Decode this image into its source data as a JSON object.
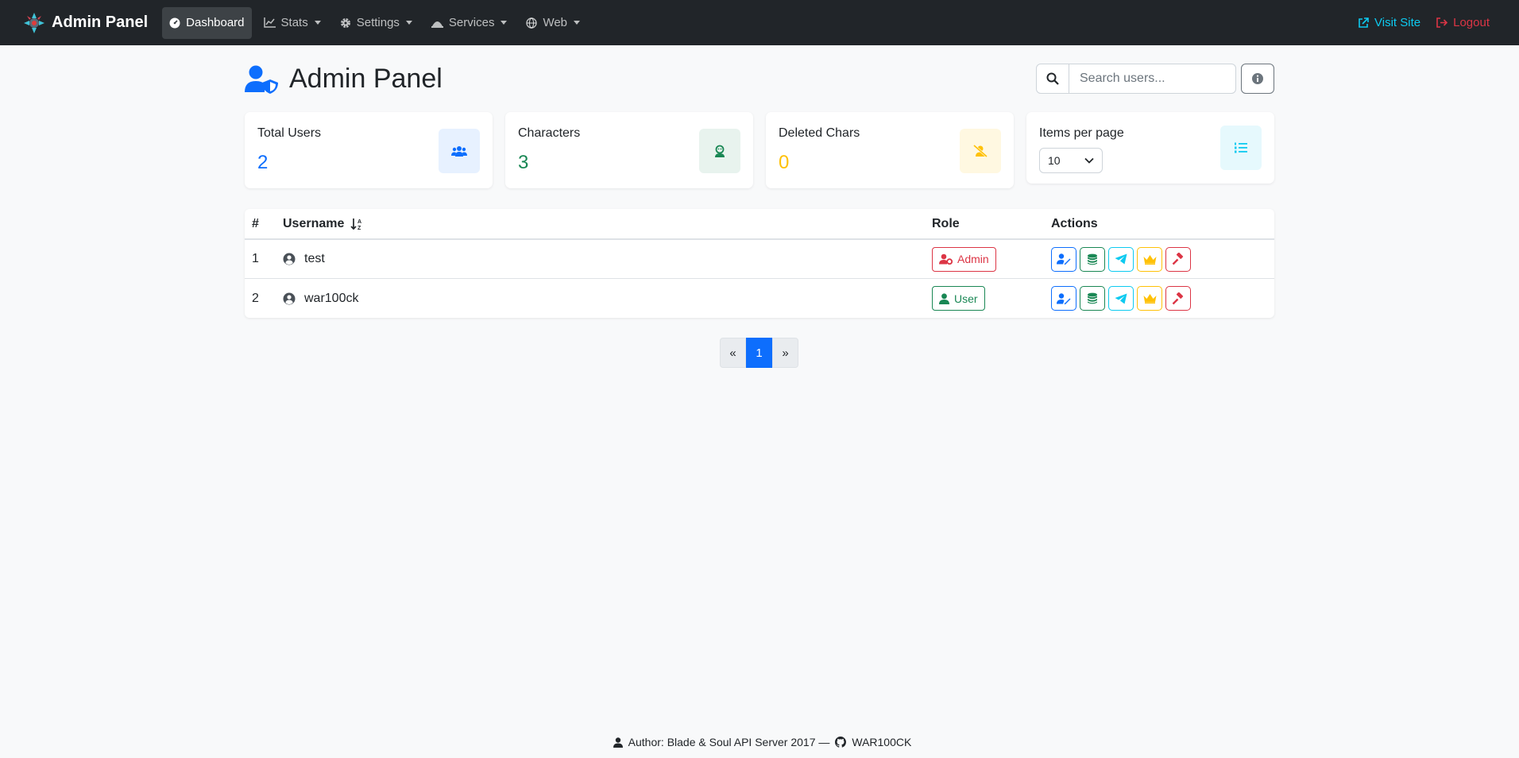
{
  "navbar": {
    "brand": "Admin Panel",
    "items": [
      {
        "label": "Dashboard",
        "icon": "dashboard-icon",
        "active": true
      },
      {
        "label": "Stats",
        "icon": "chart-icon",
        "dropdown": true
      },
      {
        "label": "Settings",
        "icon": "gear-icon",
        "dropdown": true
      },
      {
        "label": "Services",
        "icon": "bell-service-icon",
        "dropdown": true
      },
      {
        "label": "Web",
        "icon": "globe-icon",
        "dropdown": true
      }
    ],
    "visit_site": "Visit Site",
    "logout": "Logout"
  },
  "header": {
    "title": "Admin Panel",
    "search_placeholder": "Search users..."
  },
  "stats": {
    "total_users": {
      "label": "Total Users",
      "value": "2",
      "color": "#0d6efd"
    },
    "characters": {
      "label": "Characters",
      "value": "3",
      "color": "#198754"
    },
    "deleted_chars": {
      "label": "Deleted Chars",
      "value": "0",
      "color": "#ffc107"
    },
    "items_per_page": {
      "label": "Items per page",
      "value": "10"
    }
  },
  "table": {
    "headers": {
      "num": "#",
      "username": "Username",
      "role": "Role",
      "actions": "Actions"
    },
    "rows": [
      {
        "num": "1",
        "username": "test",
        "role": "Admin"
      },
      {
        "num": "2",
        "username": "war100ck",
        "role": "User"
      }
    ]
  },
  "pagination": {
    "prev": "«",
    "current": "1",
    "next": "»"
  },
  "footer": {
    "author": "Author: Blade & Soul API Server 2017 —",
    "github": "WAR100CK"
  },
  "colors": {
    "primary": "#0d6efd",
    "success": "#198754",
    "info": "#0dcaf0",
    "warning": "#ffc107",
    "danger": "#dc3545"
  }
}
